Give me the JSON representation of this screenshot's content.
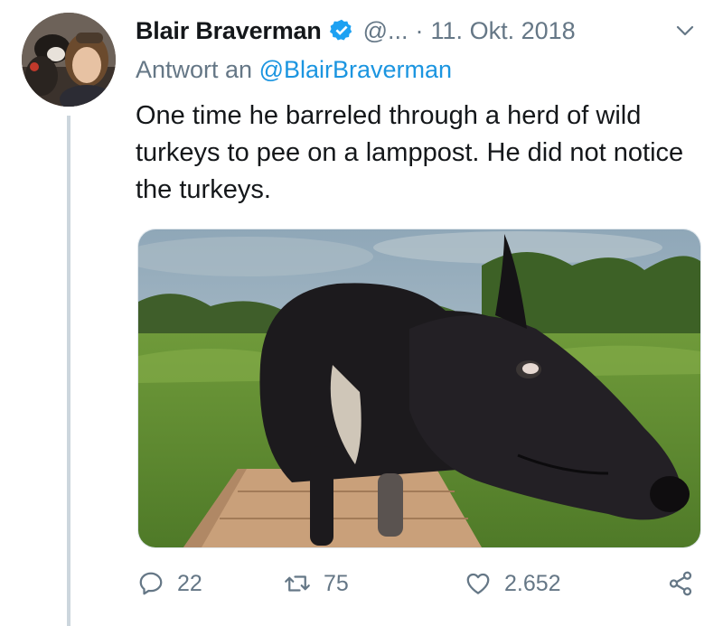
{
  "tweet": {
    "author_name": "Blair Braverman",
    "handle": "@...",
    "separator": "·",
    "date": "11. Okt. 2018",
    "reply_prefix": "Antwort an ",
    "reply_mention": "@BlairBraverman",
    "text": "One time he barreled through a herd of wild turkeys to pee on a lamppost. He did not notice the turkeys."
  },
  "actions": {
    "replies": "22",
    "retweets": "75",
    "likes": "2.652"
  },
  "colors": {
    "verified": "#1da1f2",
    "muted_text": "#657786",
    "link": "#1b95e0",
    "thread_line": "#ccd6dd"
  },
  "icons": [
    "verified-badge-icon",
    "chevron-down-icon",
    "reply-icon",
    "retweet-icon",
    "like-heart-icon",
    "share-icon"
  ]
}
